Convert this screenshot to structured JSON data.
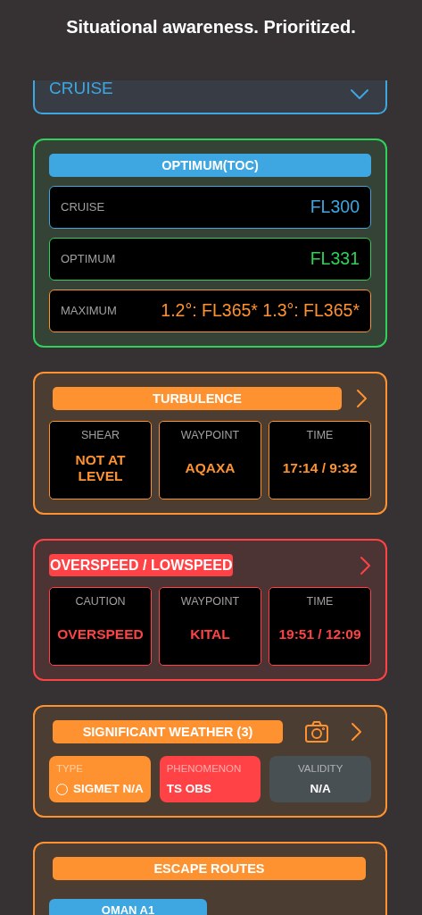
{
  "headline": "Situational awareness. Prioritized.",
  "phase_select": {
    "value": "CRUISE"
  },
  "sections": [
    {
      "kind": "levels",
      "color": "#2fd158",
      "title": {
        "text": "OPTIMUM(TOC)",
        "kind": "bar",
        "color": "#3ea6e0"
      },
      "chevron": false,
      "camera": false,
      "rows": [
        {
          "label": "CRUISE",
          "value": "FL300",
          "color": "#3ea6e0"
        },
        {
          "label": "OPTIMUM",
          "value": "FL331",
          "color": "#2fd158"
        },
        {
          "label": "MAXIMUM",
          "value": "1.2°: FL365* 1.3°: FL365*",
          "color": "#ff9230"
        }
      ]
    },
    {
      "kind": "grid",
      "color": "#ff9230",
      "title": {
        "text": "TURBULENCE",
        "kind": "bar",
        "color": "#ff9230"
      },
      "chevron": true,
      "camera": false,
      "cells": [
        {
          "label": "SHEAR",
          "value": "NOT AT LEVEL"
        },
        {
          "label": "WAYPOINT",
          "value": "AQAXA"
        },
        {
          "label": "TIME",
          "value": "17:14 / 9:32"
        }
      ]
    },
    {
      "kind": "grid",
      "color": "#ff4245",
      "title": {
        "text": "OVERSPEED / LOWSPEED",
        "kind": "tag",
        "color": "#ff4245"
      },
      "chevron": true,
      "camera": false,
      "cells": [
        {
          "label": "CAUTION",
          "value": "OVERSPEED"
        },
        {
          "label": "WAYPOINT",
          "value": "KITAL"
        },
        {
          "label": "TIME",
          "value": "19:51 / 12:09"
        }
      ]
    },
    {
      "kind": "tiles",
      "color": "#ff9230",
      "title": {
        "text": "SIGNIFICANT WEATHER (3)",
        "kind": "bar",
        "color": "#ff9230"
      },
      "chevron": true,
      "camera": true,
      "cells": [
        {
          "label": "TYPE",
          "value": "SIGMET N/A",
          "color": "#ff9230",
          "centered": false,
          "radio": {
            "selected": false
          }
        },
        {
          "label": "PHENOMENON",
          "value": "TS OBS",
          "color": "#ff4245",
          "centered": false
        },
        {
          "label": "VALIDITY",
          "value": "N/A",
          "color": "#485054",
          "centered": true
        }
      ]
    },
    {
      "kind": "routes",
      "color": "#ff9230",
      "title": {
        "text": "ESCAPE ROUTES",
        "kind": "bar",
        "color": "#ff9230"
      },
      "chevron": false,
      "camera": false,
      "routes": [
        {
          "name": "OMAN A1",
          "color": "#3ea6e0"
        }
      ]
    }
  ]
}
